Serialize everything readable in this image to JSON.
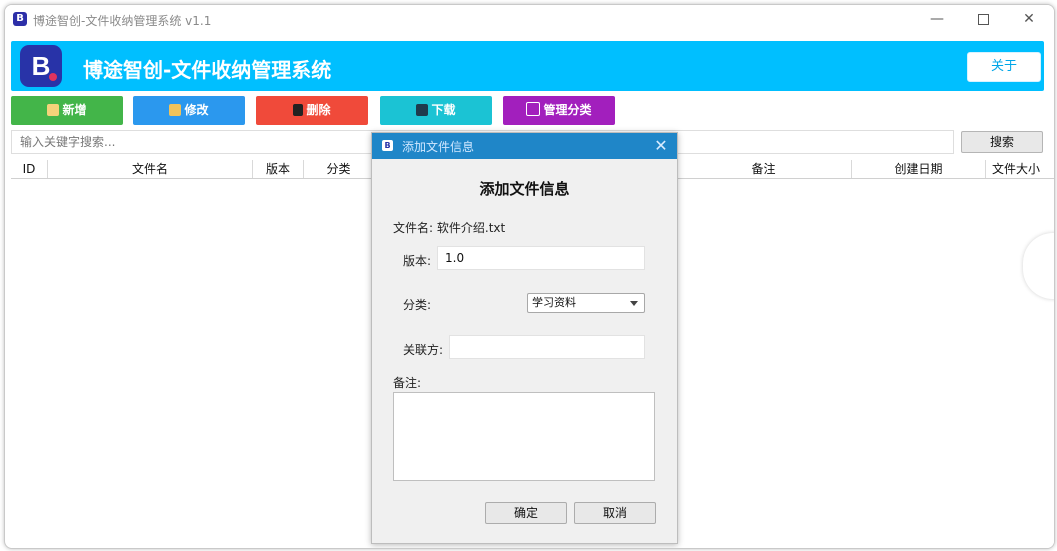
{
  "window": {
    "title": "博途智创-文件收纳管理系统 v1.1",
    "icon_letter": "B",
    "minimize": "—",
    "close": "✕"
  },
  "header": {
    "logo_letter": "B",
    "title": "博途智创-文件收纳管理系统",
    "about_label": "关于",
    "color": "#00bfff"
  },
  "toolbar": {
    "add_label": "新增",
    "edit_label": "修改",
    "delete_label": "删除",
    "download_label": "下载",
    "category_label": "管理分类",
    "colors": {
      "add": "#43b549",
      "edit": "#2b98ee",
      "delete": "#f04a3a",
      "download": "#1bc3d4",
      "category": "#a21fbd"
    }
  },
  "search": {
    "placeholder": "输入关键字搜索...",
    "value": "",
    "button_label": "搜索"
  },
  "table": {
    "columns": [
      "ID",
      "文件名",
      "版本",
      "分类",
      "备注",
      "创建日期",
      "文件大小"
    ],
    "rows": []
  },
  "dialog": {
    "title": "添加文件信息",
    "icon_letter": "B",
    "close": "✕",
    "heading": "添加文件信息",
    "filename_label": "文件名:",
    "filename_value": "软件介绍.txt",
    "version_label": "版本:",
    "version_value": "1.0",
    "category_label": "分类:",
    "category_value": "学习资料",
    "related_label": "关联方:",
    "related_value": "",
    "note_label": "备注:",
    "note_value": "",
    "ok_label": "确定",
    "cancel_label": "取消",
    "titlebar_color": "#1f86c8"
  }
}
